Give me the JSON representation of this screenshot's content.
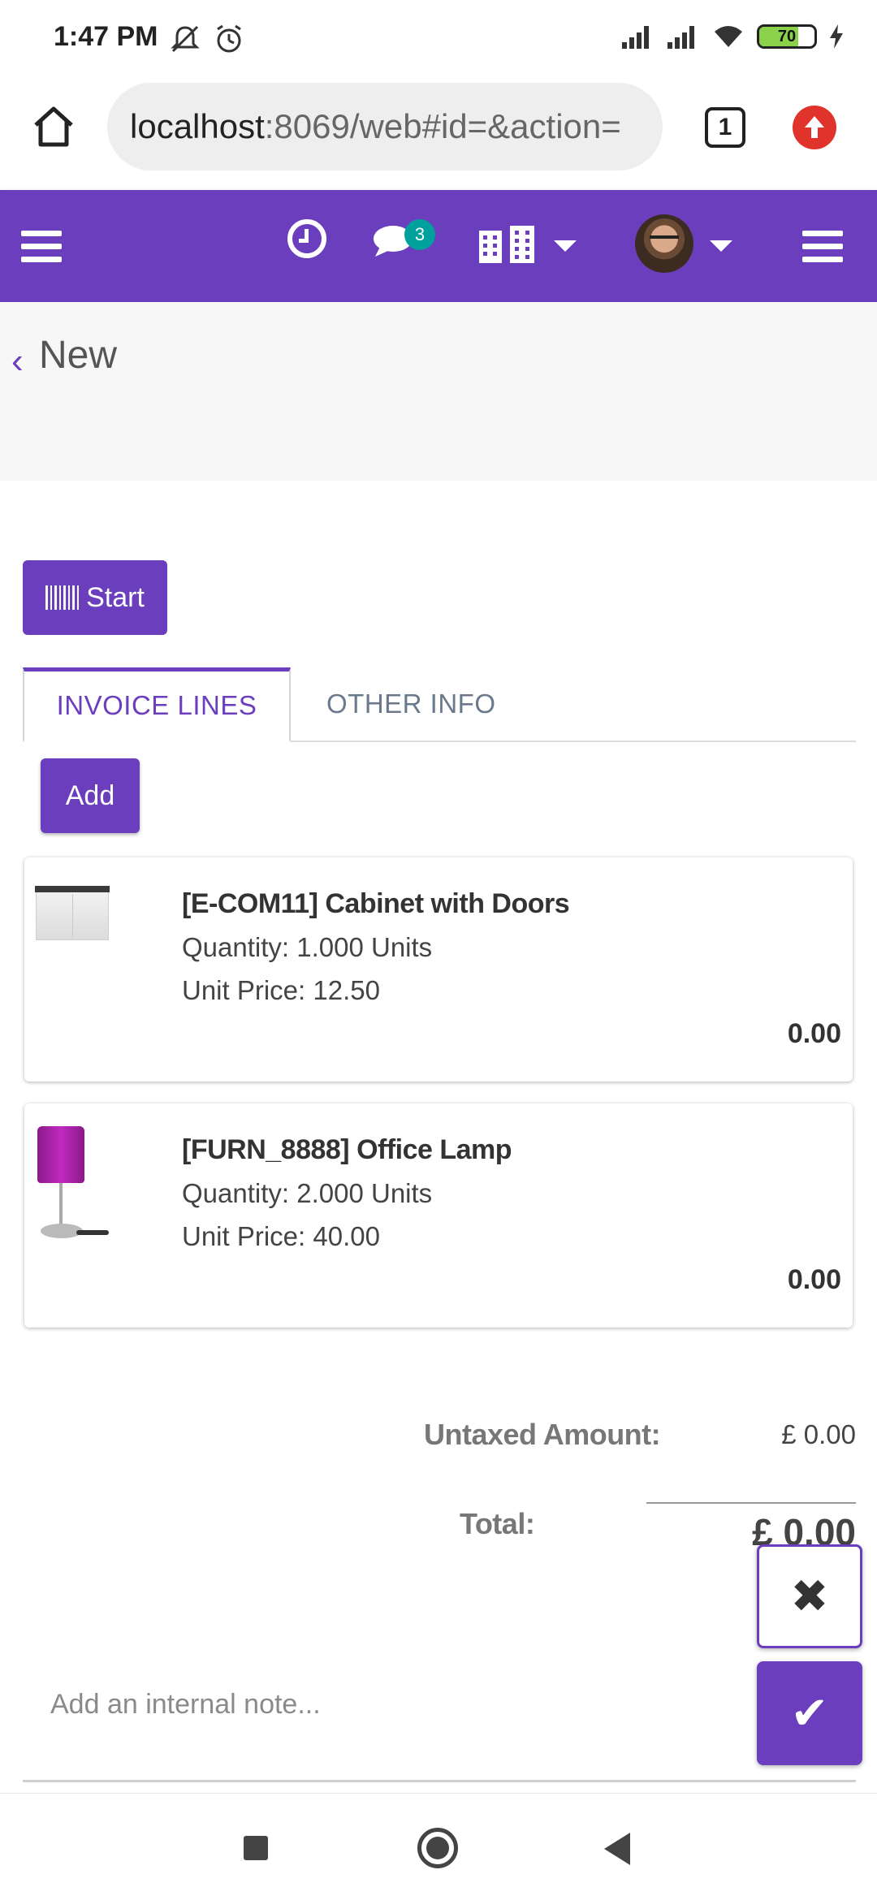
{
  "status_bar": {
    "time": "1:47 PM",
    "battery": "70",
    "icons": [
      "mute-icon",
      "alarm-icon",
      "signal-icon",
      "signal-icon",
      "wifi-icon",
      "battery-icon",
      "charging-icon"
    ]
  },
  "browser": {
    "url_host": "localhost",
    "url_rest": ":8069/web#id=&action=",
    "tab_count": "1"
  },
  "nav": {
    "messages_badge": "3",
    "accent_color": "#6b3ebd",
    "badge_color": "#00a09d"
  },
  "breadcrumb": {
    "label": "New"
  },
  "actions": {
    "start_label": "Start",
    "add_label": "Add"
  },
  "tabs": [
    {
      "label": "INVOICE LINES",
      "active": true
    },
    {
      "label": "OTHER INFO",
      "active": false
    }
  ],
  "lines": [
    {
      "name": "[E-COM11] Cabinet with Doors",
      "quantity": "Quantity: 1.000 Units",
      "unit_price": "Unit Price: 12.50",
      "subtotal": "0.00"
    },
    {
      "name": "[FURN_8888] Office Lamp",
      "quantity": "Quantity: 2.000 Units",
      "unit_price": "Unit Price: 40.00",
      "subtotal": "0.00"
    }
  ],
  "totals": {
    "untaxed_label": "Untaxed Amount:",
    "untaxed_value": "£ 0.00",
    "total_label": "Total:",
    "total_value": "£ 0.00"
  },
  "note": {
    "placeholder": "Add an internal note..."
  },
  "buttons": {
    "discard_symbol": "✖",
    "save_symbol": "✔"
  }
}
